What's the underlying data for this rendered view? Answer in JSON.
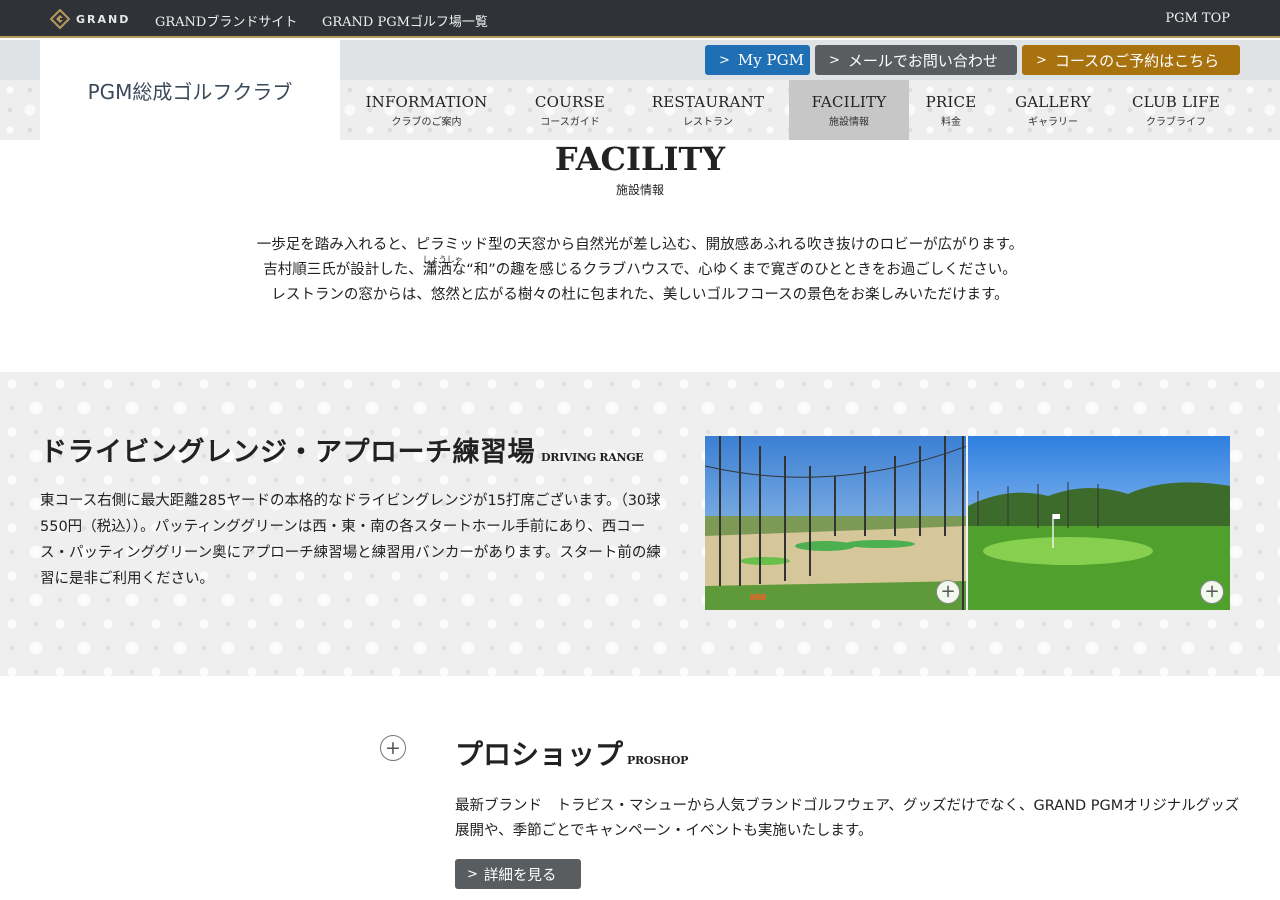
{
  "topbar": {
    "brand": "GRAND",
    "links": [
      "GRANDブランドサイト",
      "GRAND PGMゴルフ場一覧"
    ],
    "right_link": "PGM TOP"
  },
  "header": {
    "club_name": "PGM総成ゴルフクラブ",
    "buttons": {
      "mypgm": "My PGM",
      "mail": "メールでお問い合わせ",
      "reserve": "コースのご予約はこちら"
    }
  },
  "nav": {
    "items": [
      {
        "en": "INFORMATION",
        "ja": "クラブのご案内"
      },
      {
        "en": "COURSE",
        "ja": "コースガイド"
      },
      {
        "en": "RESTAURANT",
        "ja": "レストラン"
      },
      {
        "en": "FACILITY",
        "ja": "施設情報"
      },
      {
        "en": "PRICE",
        "ja": "料金"
      },
      {
        "en": "GALLERY",
        "ja": "ギャラリー"
      },
      {
        "en": "CLUB LIFE",
        "ja": "クラブライフ"
      }
    ],
    "active": "FACILITY"
  },
  "page": {
    "title": "FACILITY",
    "subtitle": "施設情報",
    "intro": {
      "line1": "一歩足を踏み入れると、ピラミッド型の天窓から自然光が差し込む、開放感あふれる吹き抜けのロビーが広がります。",
      "line2_a": "吉村順三氏が設計した、",
      "line2_ruby_base": "瀟洒",
      "line2_ruby_text": "しょうしゃ",
      "line2_b": "な“和”の趣を感じるクラブハウスで、心ゆくまで寛ぎのひとときをお過ごしください。",
      "line3": "レストランの窓からは、悠然と広がる樹々の杜に包まれた、美しいゴルフコースの景色をお楽しみいただけます。"
    }
  },
  "driving_range": {
    "title": "ドライビングレンジ・アプローチ練習場",
    "title_en": "DRIVING RANGE",
    "text": "東コース右側に最大距離285ヤードの本格的なドライビングレンジが15打席ございます。（30球550円（税込））。パッティンググリーンは西・東・南の各スタートホール手前にあり、西コース・パッティンググリーン奥にアプローチ練習場と練習用バンカーがあります。スタート前の練習に是非ご利用ください。",
    "plus": "+"
  },
  "proshop": {
    "title": "プロショップ",
    "title_en": "PROSHOP",
    "text": "最新ブランド　トラビス・マシューから人気ブランドゴルフウェア、グッズだけでなく、GRAND PGMオリジナルグッズ展開や、季節ごとでキャンペーン・イベントも実施いたします。",
    "button": "詳細を見る",
    "plus": "+"
  },
  "icons": {
    "chevron": "chevron-right-icon",
    "expand": "plus-circle-icon"
  },
  "colors": {
    "topbar": "#2f3338",
    "gold_line": "#b79a5a",
    "mypgm": "#1f6fb5",
    "mail": "#5a5d60",
    "reserve": "#a8720f",
    "nav_active": "#c7c7c7"
  }
}
